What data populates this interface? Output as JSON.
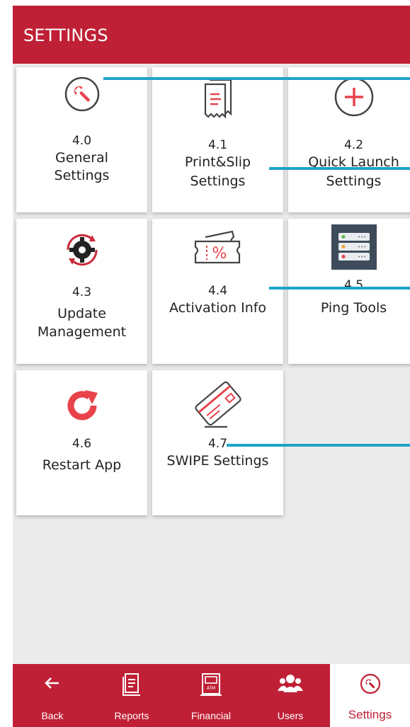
{
  "header": {
    "title": "SETTINGS"
  },
  "tiles": [
    {
      "num": "4.0",
      "line1": "General",
      "line2": "Settings",
      "icon": "wrench-icon"
    },
    {
      "num": "4.1",
      "line1": "Print&Slip",
      "line2": "Settings",
      "icon": "receipt-icon"
    },
    {
      "num": "4.2",
      "line1": "Quick Launch",
      "line2": "Settings",
      "icon": "plus-circle-icon"
    },
    {
      "num": "4.3",
      "line1": "Update",
      "line2": "Management",
      "icon": "gear-refresh-icon"
    },
    {
      "num": "4.4",
      "line1": "Activation Info",
      "line2": "",
      "icon": "discount-ticket-icon"
    },
    {
      "num": "4.5",
      "line1": "Ping Tools",
      "line2": "",
      "icon": "server-icon"
    },
    {
      "num": "4.6",
      "line1": "Restart App",
      "line2": "",
      "icon": "restart-icon"
    },
    {
      "num": "4.7",
      "line1": "SWIPE Settings",
      "line2": "",
      "icon": "card-swipe-icon"
    }
  ],
  "tabs": [
    {
      "label": "Back",
      "icon": "arrow-left-icon"
    },
    {
      "label": "Reports",
      "icon": "report-icon"
    },
    {
      "label": "Financial",
      "icon": "atm-icon"
    },
    {
      "label": "Users",
      "icon": "users-icon"
    },
    {
      "label": "Settings",
      "icon": "wrench-icon",
      "active": true
    }
  ],
  "colors": {
    "brand": "#bf2035",
    "callout": "#1ea4c9",
    "background": "#ebebeb"
  }
}
